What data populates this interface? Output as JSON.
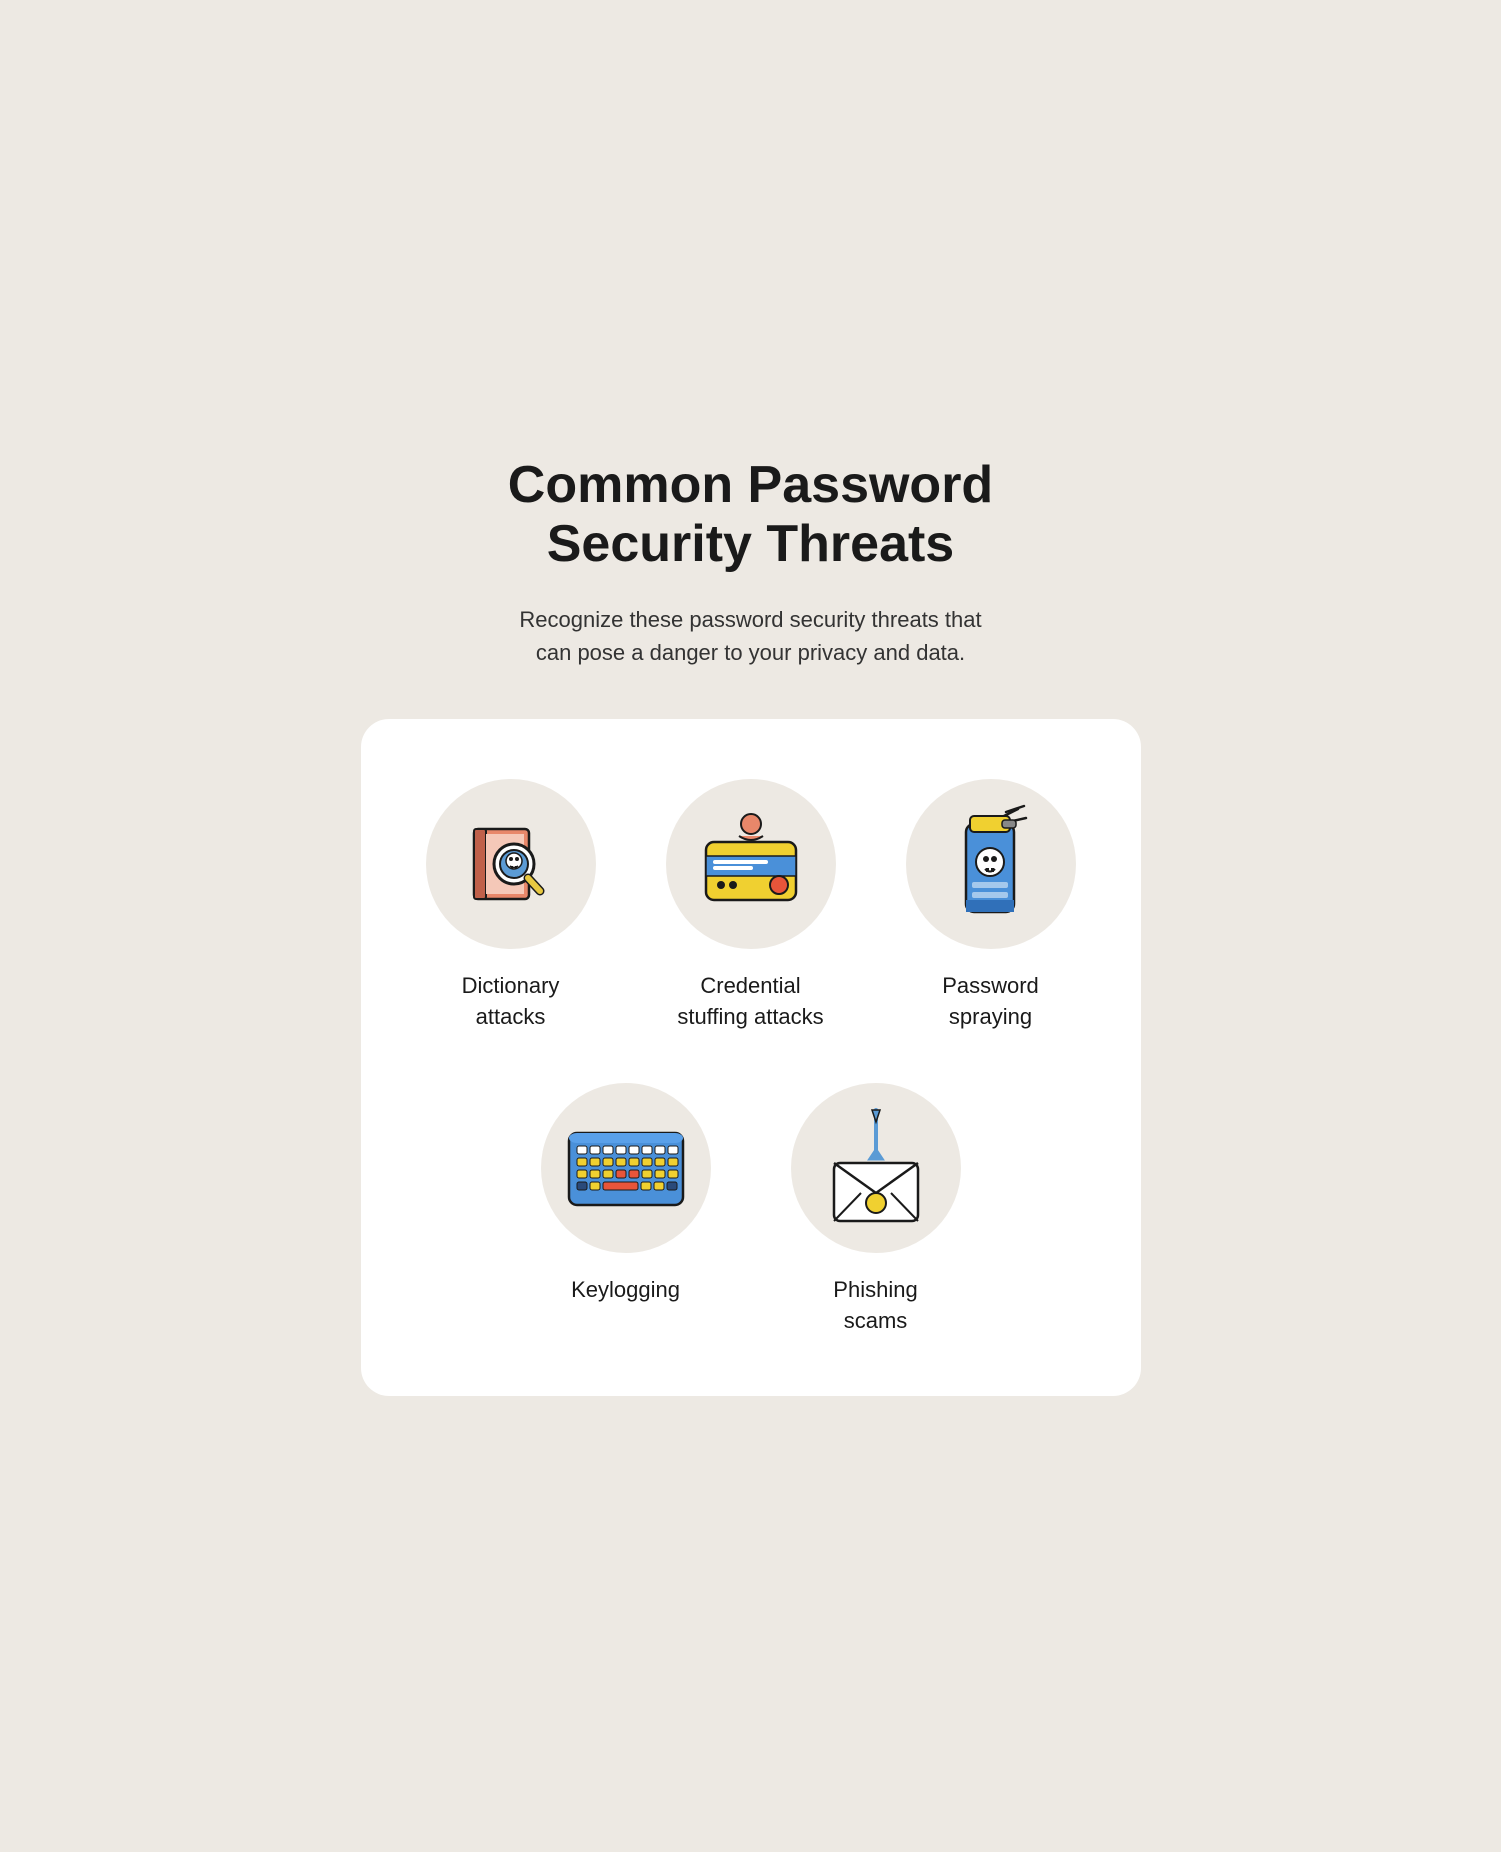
{
  "page": {
    "title": "Common Password\nSecurity Threats",
    "subtitle": "Recognize these password security threats that can pose a danger to your privacy and data.",
    "threats": [
      {
        "id": "dictionary-attacks",
        "label": "Dictionary\nattacks",
        "icon": "dictionary-icon"
      },
      {
        "id": "credential-stuffing",
        "label": "Credential\nstuffing attacks",
        "icon": "credential-icon"
      },
      {
        "id": "password-spraying",
        "label": "Password\nspraying",
        "icon": "spray-icon"
      },
      {
        "id": "keylogging",
        "label": "Keylogging",
        "icon": "keyboard-icon"
      },
      {
        "id": "phishing-scams",
        "label": "Phishing\nscams",
        "icon": "phishing-icon"
      }
    ]
  }
}
